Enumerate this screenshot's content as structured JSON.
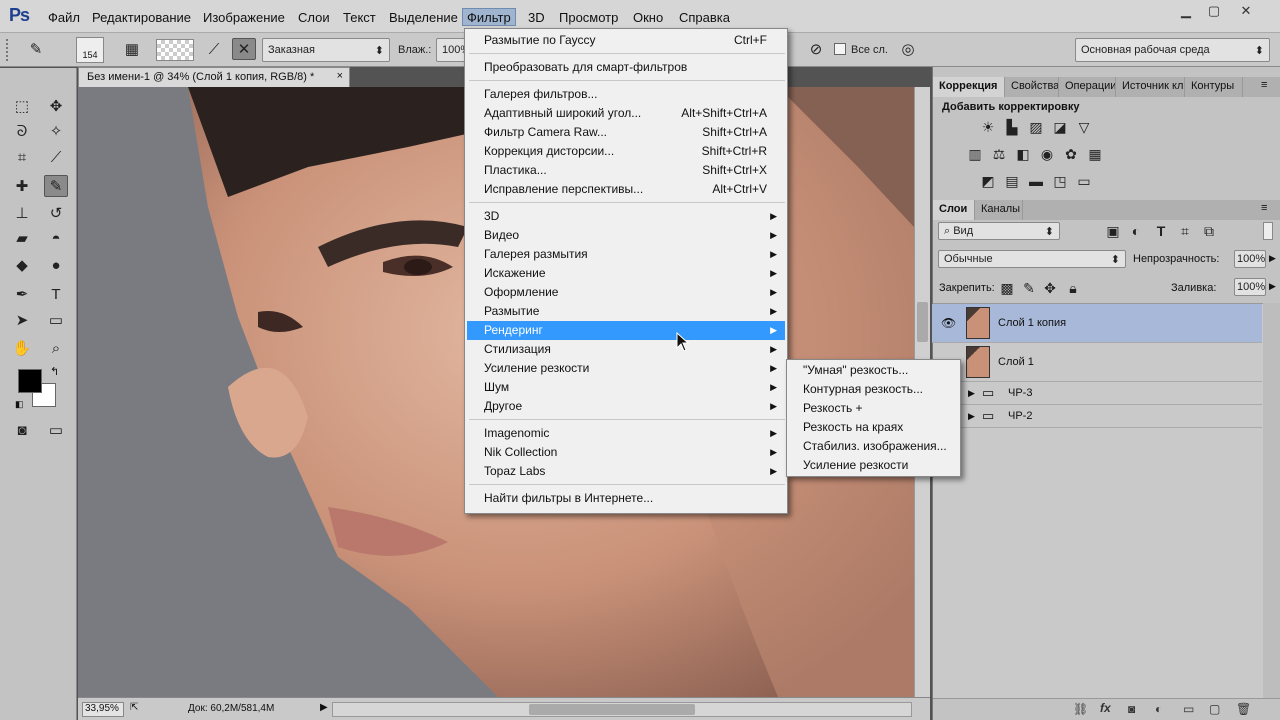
{
  "app": {
    "logo": "Ps"
  },
  "menubar": {
    "items": [
      "Файл",
      "Редактирование",
      "Изображение",
      "Слои",
      "Текст",
      "Выделение",
      "Фильтр",
      "3D",
      "Просмотр",
      "Окно",
      "Справка"
    ],
    "active_index": 6
  },
  "options_bar": {
    "brush_size": "154",
    "mode": "Заказная",
    "wet_label": "Влаж.:",
    "wet_value": "100%",
    "all_layers": "Все сл.",
    "workspace": "Основная рабочая среда"
  },
  "document": {
    "tab_title": "Без имени-1 @ 34% (Слой 1 копия, RGB/8) *",
    "close": "×",
    "zoom": "33,95%",
    "doc_info": "Док: 60,2M/581,4M"
  },
  "filter_menu": {
    "groups": [
      [
        {
          "label": "Размытие по Гауссу",
          "shortcut": "Ctrl+F"
        }
      ],
      [
        {
          "label": "Преобразовать для смарт-фильтров",
          "shortcut": ""
        }
      ],
      [
        {
          "label": "Галерея фильтров...",
          "shortcut": ""
        },
        {
          "label": "Адаптивный широкий угол...",
          "shortcut": "Alt+Shift+Ctrl+A"
        },
        {
          "label": "Фильтр Camera Raw...",
          "shortcut": "Shift+Ctrl+A"
        },
        {
          "label": "Коррекция дисторсии...",
          "shortcut": "Shift+Ctrl+R"
        },
        {
          "label": "Пластика...",
          "shortcut": "Shift+Ctrl+X"
        },
        {
          "label": "Исправление перспективы...",
          "shortcut": "Alt+Ctrl+V"
        }
      ],
      [
        {
          "label": "3D",
          "submenu": true
        },
        {
          "label": "Видео",
          "submenu": true
        },
        {
          "label": "Галерея размытия",
          "submenu": true
        },
        {
          "label": "Искажение",
          "submenu": true
        },
        {
          "label": "Оформление",
          "submenu": true
        },
        {
          "label": "Размытие",
          "submenu": true
        },
        {
          "label": "Рендеринг",
          "submenu": true,
          "highlighted": true
        },
        {
          "label": "Стилизация",
          "submenu": true
        },
        {
          "label": "Усиление резкости",
          "submenu": true
        },
        {
          "label": "Шум",
          "submenu": true
        },
        {
          "label": "Другое",
          "submenu": true
        }
      ],
      [
        {
          "label": "Imagenomic",
          "submenu": true
        },
        {
          "label": "Nik Collection",
          "submenu": true
        },
        {
          "label": "Topaz Labs",
          "submenu": true
        }
      ],
      [
        {
          "label": "Найти фильтры в Интернете...",
          "shortcut": ""
        }
      ]
    ]
  },
  "sharpen_submenu": {
    "items": [
      "\"Умная\" резкость...",
      "Контурная резкость...",
      "Резкость +",
      "Резкость на краях",
      "Стабилиз. изображения...",
      "Усиление резкости"
    ]
  },
  "adjustments_panel": {
    "tabs": [
      "Коррекция",
      "Свойства",
      "Операции",
      "Источник кл",
      "Контуры"
    ],
    "heading": "Добавить корректировку"
  },
  "layers_panel": {
    "tabs": [
      "Слои",
      "Каналы"
    ],
    "filter_kind": "Вид",
    "blend_mode": "Обычные",
    "opacity_label": "Непрозрачность:",
    "opacity_value": "100%",
    "lock_label": "Закрепить:",
    "fill_label": "Заливка:",
    "fill_value": "100%",
    "layers": [
      {
        "name": "Слой 1 копия",
        "visible": true,
        "selected": true,
        "type": "pixel"
      },
      {
        "name": "Слой 1",
        "visible": false,
        "selected": false,
        "type": "pixel"
      },
      {
        "name": "ЧР-3",
        "visible": false,
        "selected": false,
        "type": "group"
      },
      {
        "name": "ЧР-2",
        "visible": false,
        "selected": false,
        "type": "group"
      }
    ]
  },
  "colors": {
    "highlight": "#3399ff",
    "layer_selected": "#a8b8d8",
    "foreground": "#000000",
    "background": "#ffffff"
  }
}
